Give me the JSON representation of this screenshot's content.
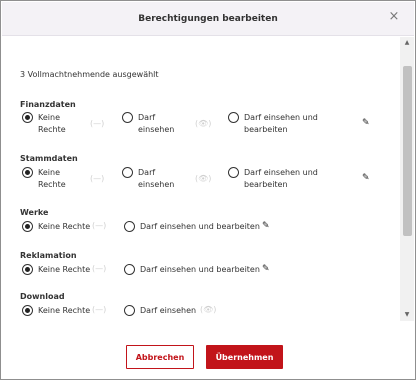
{
  "dialog": {
    "title": "Berechtigungen bearbeiten",
    "close_icon": "×",
    "selected_text": "3 Vollmachtnehmende ausgewählt",
    "scroll_up": "▲",
    "scroll_down": "▼"
  },
  "sections": {
    "finanz": {
      "title": "Finanzdaten",
      "keine": "Keine\nRechte",
      "darf_einsehen": "Darf\neinsehen",
      "darf_bearbeiten": "Darf einsehen und\nbearbeiten"
    },
    "stamm": {
      "title": "Stammdaten",
      "keine": "Keine\nRechte",
      "darf_einsehen": "Darf\neinsehen",
      "darf_bearbeiten": "Darf einsehen und\nbearbeiten"
    },
    "werke": {
      "title": "Werke",
      "keine": "Keine Rechte",
      "darf_bearbeiten": "Darf einsehen und bearbeiten"
    },
    "reklamation": {
      "title": "Reklamation",
      "keine": "Keine Rechte",
      "darf_bearbeiten": "Darf einsehen und bearbeiten"
    },
    "download": {
      "title": "Download",
      "keine": "Keine Rechte",
      "darf_einsehen": "Darf einsehen"
    }
  },
  "icons": {
    "none": "(—)",
    "eye": "(👁)",
    "pen": "✎"
  },
  "buttons": {
    "cancel": "Abbrechen",
    "apply": "Übernehmen"
  },
  "colors": {
    "accent": "#c2141a",
    "header_bg": "#f4f2f6"
  }
}
